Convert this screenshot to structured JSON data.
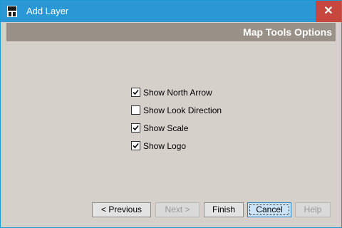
{
  "window": {
    "title": "Add Layer",
    "close_glyph": "✕",
    "icon": "app-logo-icon"
  },
  "header": {
    "title": "Map Tools Options"
  },
  "options": [
    {
      "label": "Show North Arrow",
      "checked": true
    },
    {
      "label": "Show Look Direction",
      "checked": false
    },
    {
      "label": "Show Scale",
      "checked": true
    },
    {
      "label": "Show Logo",
      "checked": true
    }
  ],
  "buttons": {
    "previous": "< Previous",
    "next": "Next >",
    "finish": "Finish",
    "cancel": "Cancel",
    "help": "Help"
  },
  "colors": {
    "titlebar": "#2b98d5",
    "close": "#c7463f",
    "header_band": "#999188",
    "background": "#d6d0ca"
  }
}
